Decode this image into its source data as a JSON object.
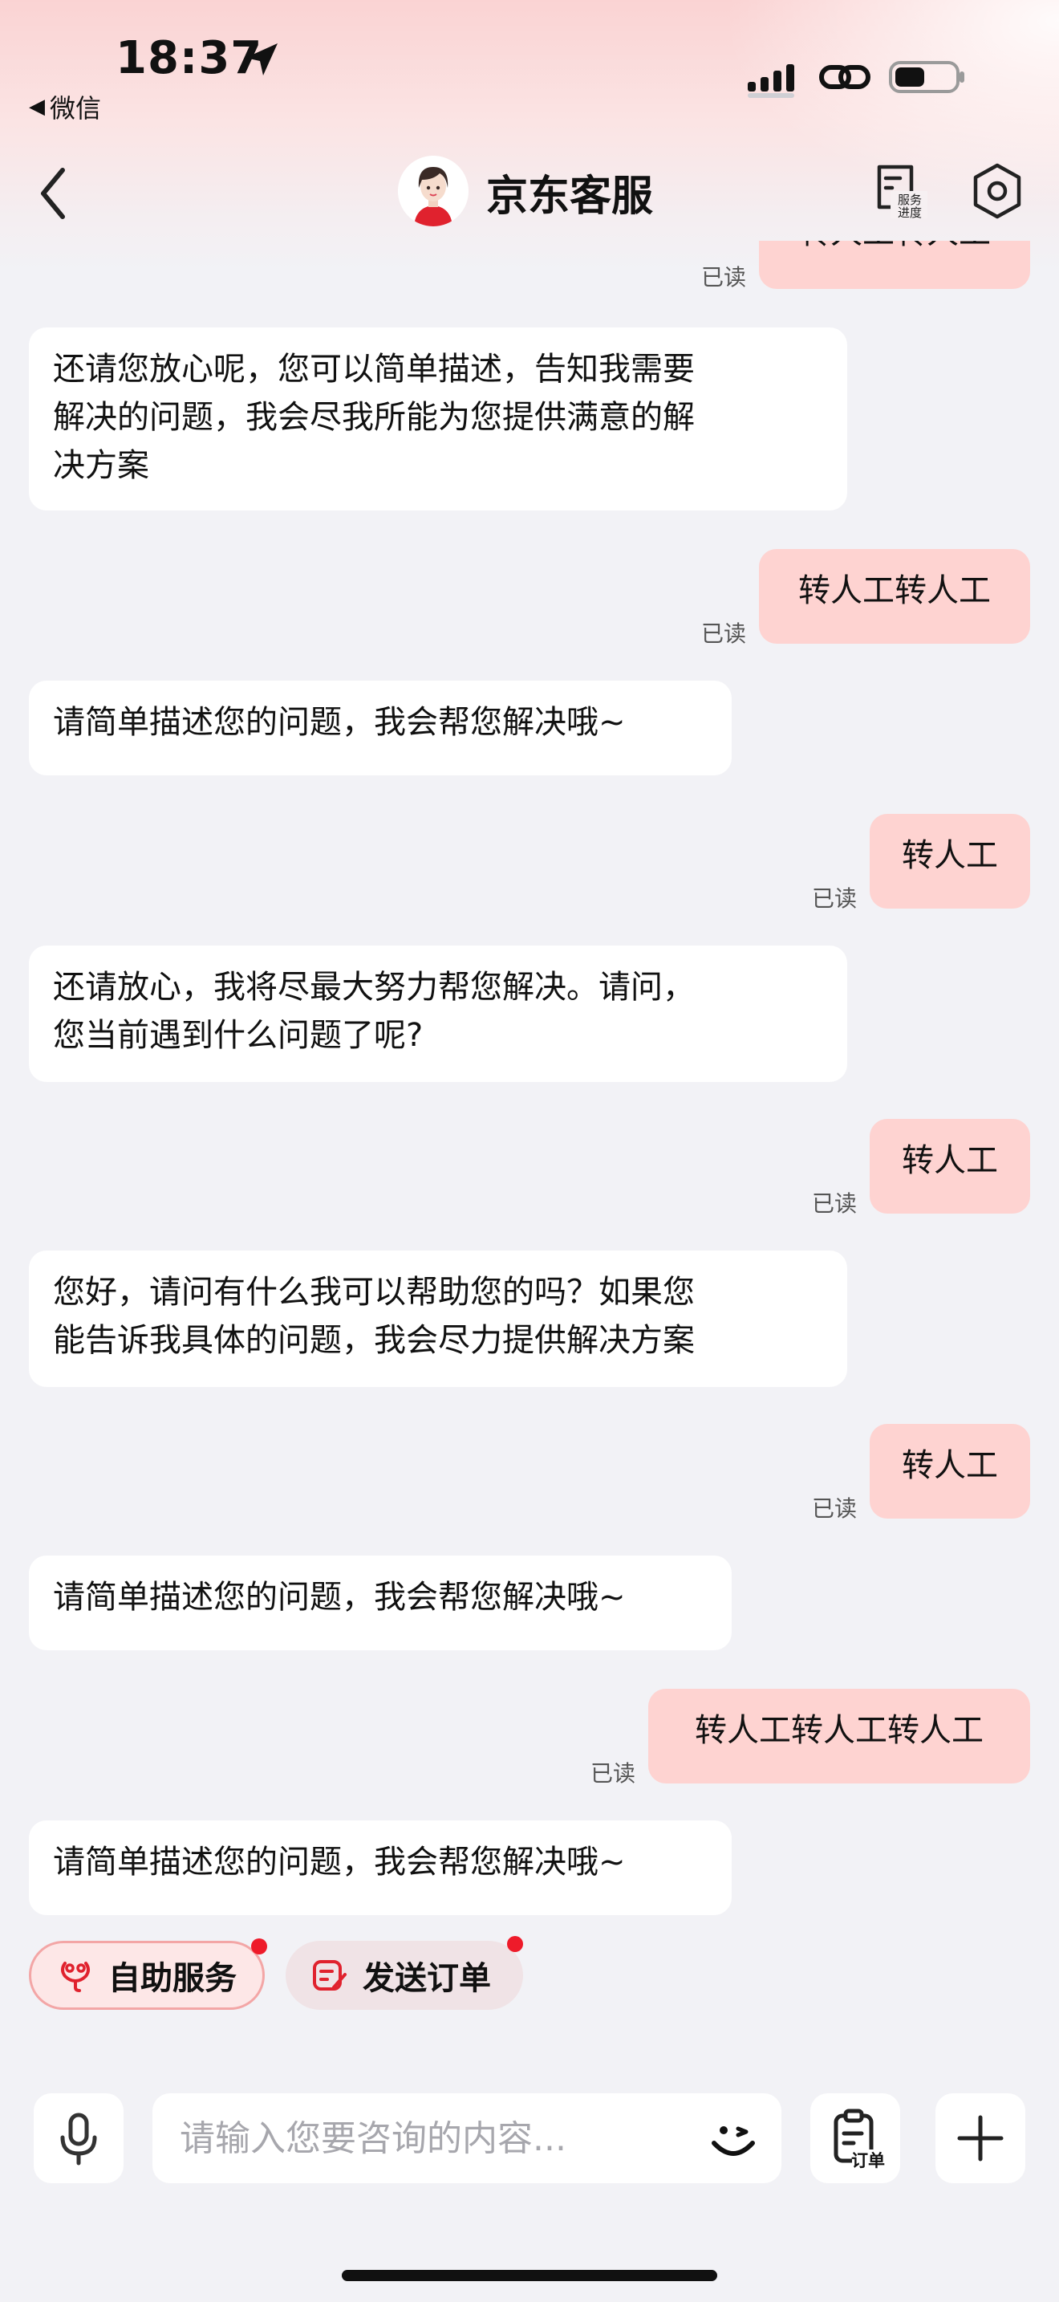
{
  "status_bar": {
    "time": "18:37",
    "back_app": "微信",
    "back_triangle": "◀"
  },
  "header": {
    "title": "京东客服",
    "service_progress_label_1": "服务",
    "service_progress_label_2": "进度"
  },
  "messages": [
    {
      "role": "user",
      "text": "转人工转人工",
      "read": "已读"
    },
    {
      "role": "bot",
      "lines": [
        "还请您放心呢，您可以简单描述，告知我需要",
        "解决的问题，我会尽我所能为您提供满意的解",
        "决方案"
      ]
    },
    {
      "role": "user",
      "text": "转人工转人工",
      "read": "已读"
    },
    {
      "role": "bot",
      "lines": [
        "请简单描述您的问题，我会帮您解决哦~"
      ]
    },
    {
      "role": "user",
      "text": "转人工",
      "read": "已读"
    },
    {
      "role": "bot",
      "lines": [
        "还请放心，我将尽最大努力帮您解决。请问，",
        "您当前遇到什么问题了呢?"
      ]
    },
    {
      "role": "user",
      "text": "转人工",
      "read": "已读"
    },
    {
      "role": "bot",
      "lines": [
        "您好，请问有什么我可以帮助您的吗？如果您",
        "能告诉我具体的问题，我会尽力提供解决方案"
      ]
    },
    {
      "role": "user",
      "text": "转人工",
      "read": "已读"
    },
    {
      "role": "bot",
      "lines": [
        "请简单描述您的问题，我会帮您解决哦~"
      ]
    },
    {
      "role": "user",
      "text": "转人工转人工转人工",
      "read": "已读"
    },
    {
      "role": "bot",
      "lines": [
        "请简单描述您的问题，我会帮您解决哦~"
      ]
    }
  ],
  "quick_actions": {
    "self_service": "自助服务",
    "send_order": "发送订单"
  },
  "input": {
    "placeholder": "请输入您要咨询的内容...",
    "order_label": "订单"
  },
  "colors": {
    "user_bubble": "#fed3d1",
    "bot_bubble": "#ffffff",
    "accent_red": "#ee1b2a",
    "background": "#f2f2f6"
  }
}
